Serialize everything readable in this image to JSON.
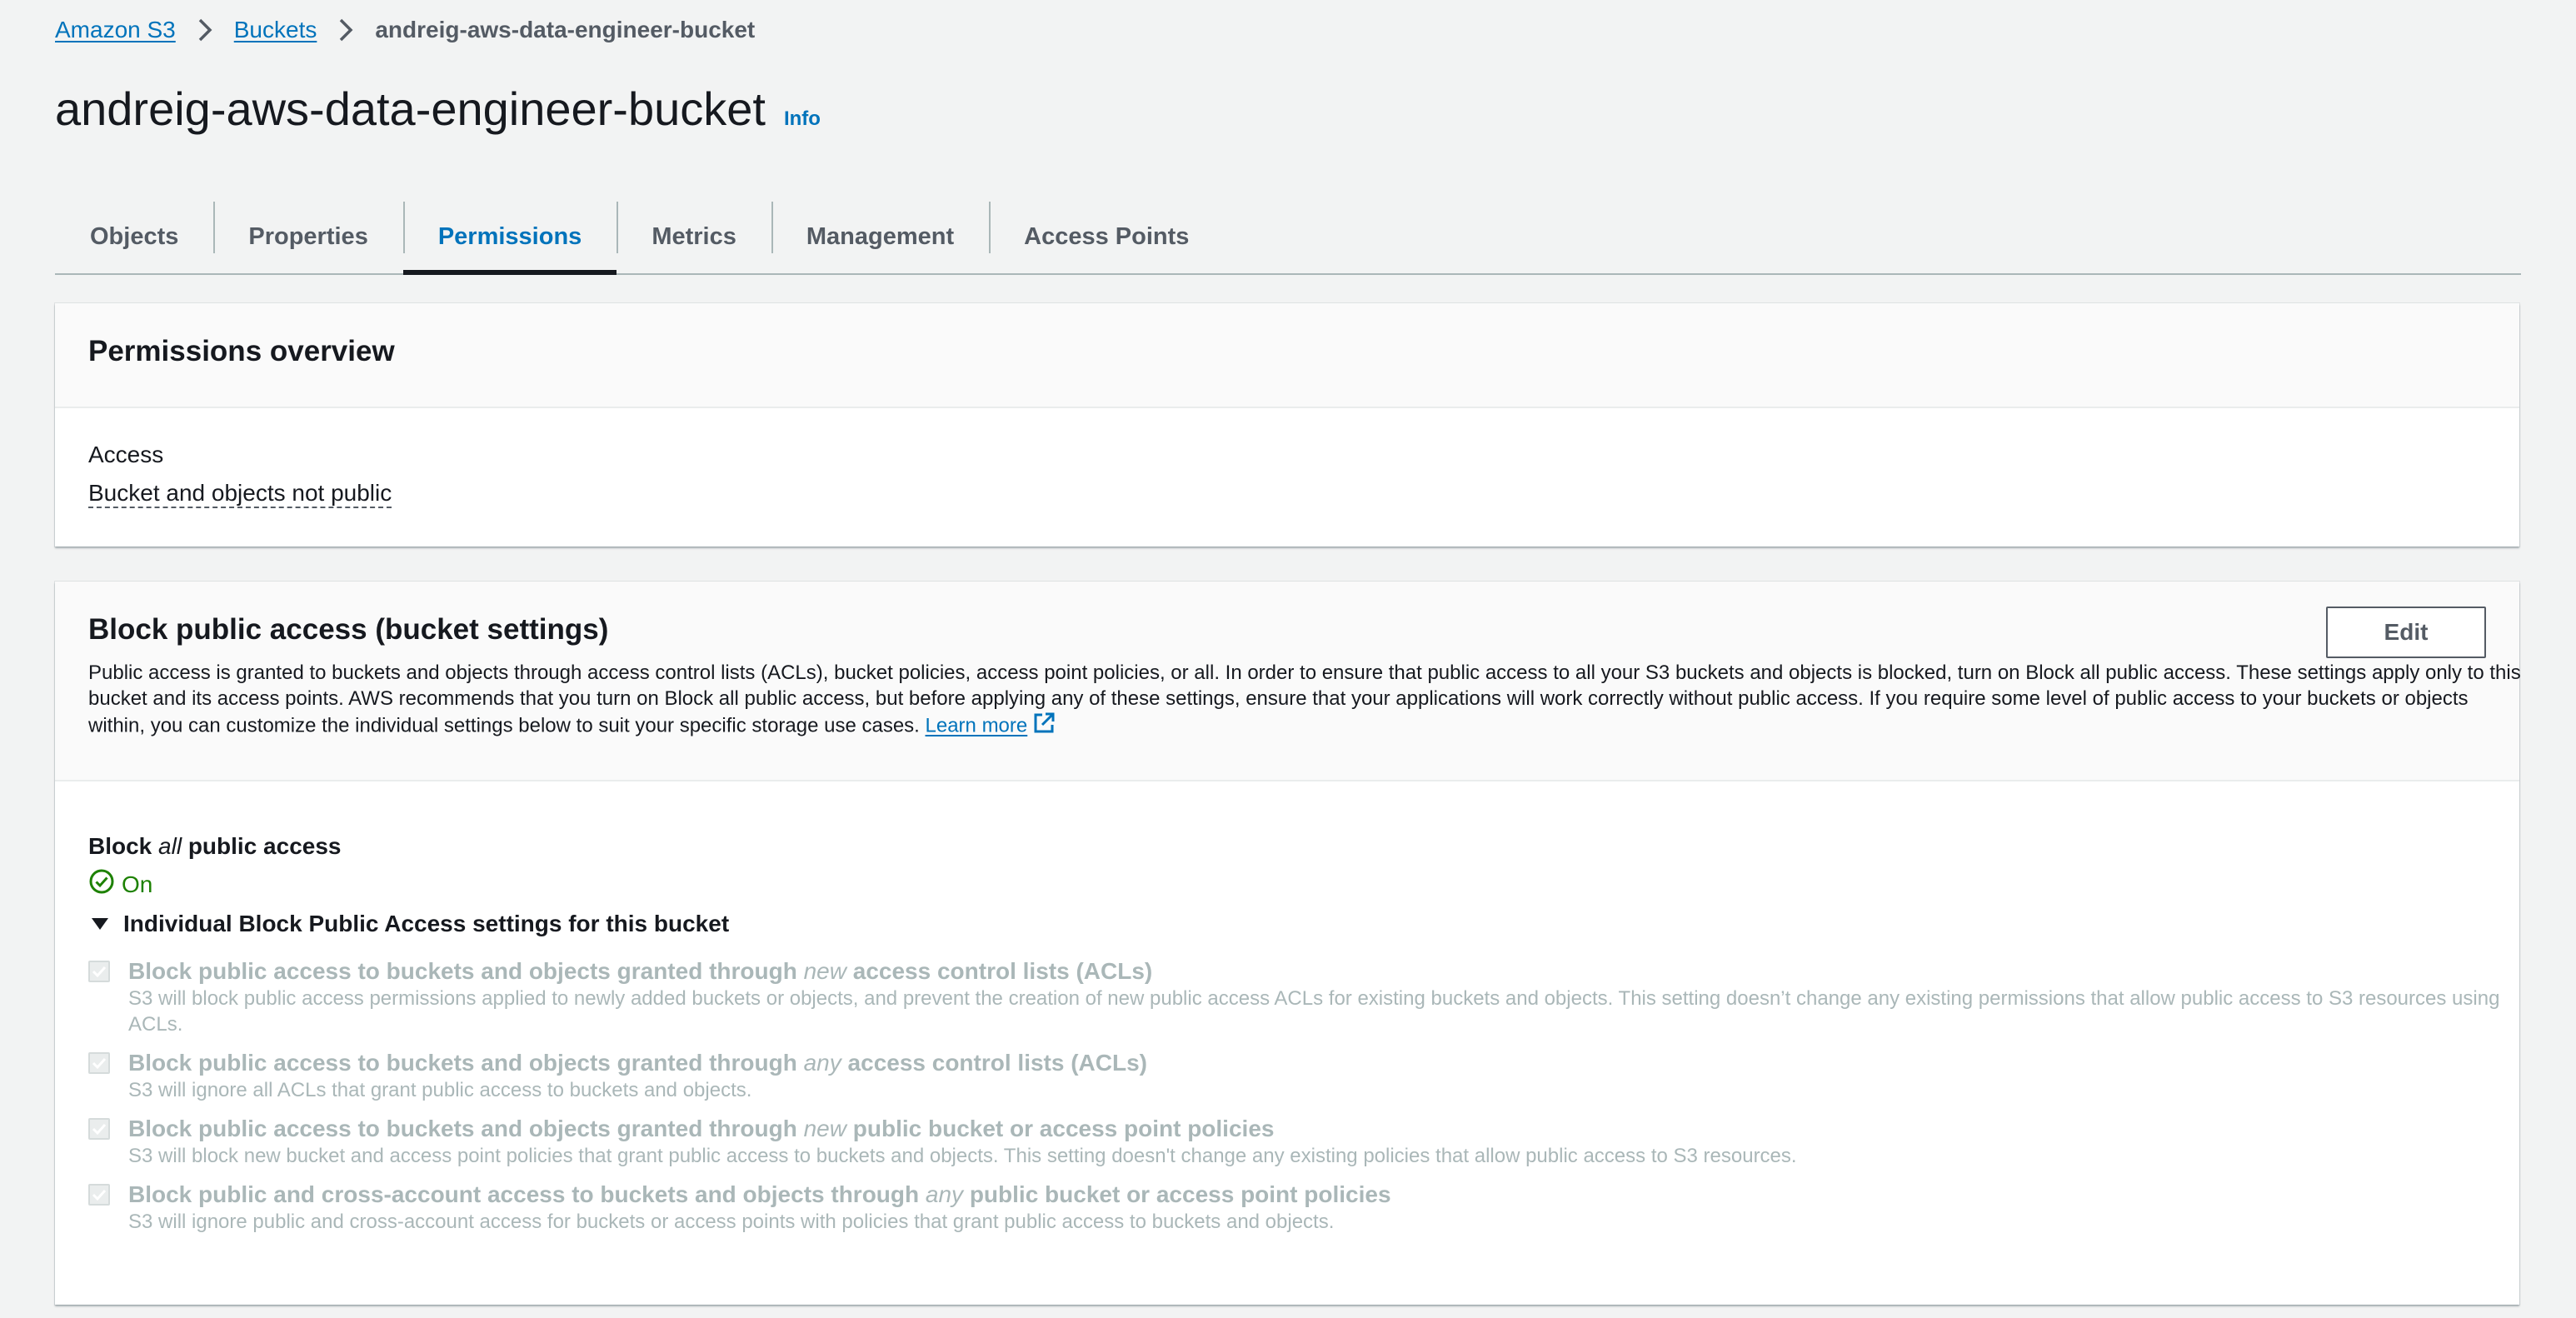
{
  "breadcrumb": {
    "items": [
      "Amazon S3",
      "Buckets"
    ],
    "current": "andreig-aws-data-engineer-bucket"
  },
  "page": {
    "title": "andreig-aws-data-engineer-bucket",
    "info": "Info"
  },
  "tabs": [
    {
      "label": "Objects"
    },
    {
      "label": "Properties"
    },
    {
      "label": "Permissions",
      "active": true
    },
    {
      "label": "Metrics"
    },
    {
      "label": "Management"
    },
    {
      "label": "Access Points"
    }
  ],
  "overview": {
    "title": "Permissions overview",
    "access_label": "Access",
    "access_value": "Bucket and objects not public"
  },
  "block_public_access": {
    "title": "Block public access (bucket settings)",
    "edit_label": "Edit",
    "description": "Public access is granted to buckets and objects through access control lists (ACLs), bucket policies, access point policies, or all. In order to ensure that public access to all your S3 buckets and objects is blocked, turn on Block all public access. These settings apply only to this bucket and its access points. AWS recommends that you turn on Block all public access, but before applying any of these settings, ensure that your applications will work correctly without public access. If you require some level of public access to your buckets or objects within, you can customize the individual settings below to suit your specific storage use cases.",
    "learn_more": "Learn more",
    "block_all_prefix": "Block",
    "block_all_em": "all",
    "block_all_suffix": "public access",
    "status": "On",
    "individual_heading": "Individual Block Public Access settings for this bucket",
    "settings": [
      {
        "title_pre": "Block public access to buckets and objects granted through",
        "title_em": "new",
        "title_post": "access control lists (ACLs)",
        "description": "S3 will block public access permissions applied to newly added buckets or objects, and prevent the creation of new public access ACLs for existing buckets and objects. This setting doesn’t change any existing permissions that allow public access to S3 resources using ACLs.",
        "checked": true
      },
      {
        "title_pre": "Block public access to buckets and objects granted through",
        "title_em": "any",
        "title_post": "access control lists (ACLs)",
        "description": "S3 will ignore all ACLs that grant public access to buckets and objects.",
        "checked": true
      },
      {
        "title_pre": "Block public access to buckets and objects granted through",
        "title_em": "new",
        "title_post": "public bucket or access point policies",
        "description": "S3 will block new bucket and access point policies that grant public access to buckets and objects. This setting doesn't change any existing policies that allow public access to S3 resources.",
        "checked": true
      },
      {
        "title_pre": "Block public and cross-account access to buckets and objects through",
        "title_em": "any",
        "title_post": "public bucket or access point policies",
        "description": "S3 will ignore public and cross-account access for buckets or access points with policies that grant public access to buckets and objects.",
        "checked": true
      }
    ]
  },
  "colors": {
    "link": "#0073bb",
    "success": "#1d8102",
    "disabled_text": "#aab7b8",
    "background": "#f2f3f3"
  },
  "icons": [
    "chevron-right-icon",
    "external-link-icon",
    "check-circle-icon",
    "caret-down-icon",
    "checkbox-check-icon"
  ]
}
